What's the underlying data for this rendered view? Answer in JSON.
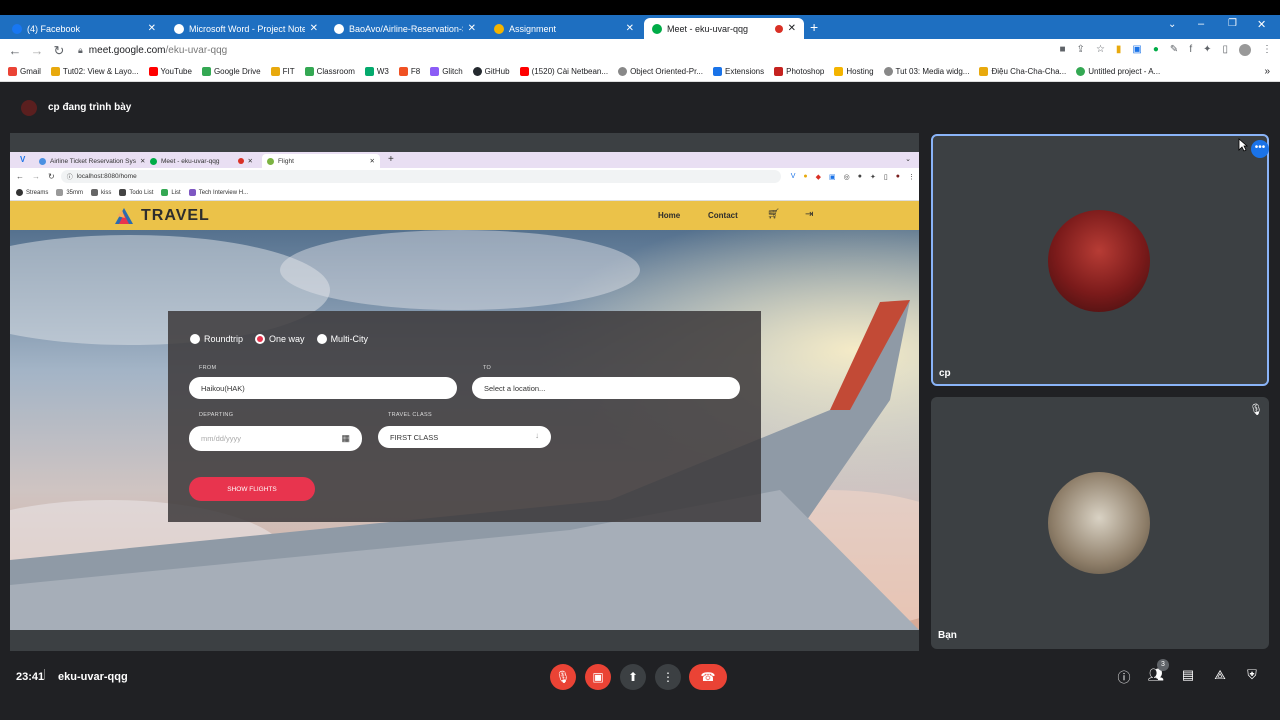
{
  "browser": {
    "tabs": [
      {
        "title": "(4) Facebook",
        "icon": "facebook-icon",
        "color": "#1877f2"
      },
      {
        "title": "Microsoft Word - Project Note",
        "icon": "globe-icon",
        "color": "#ffffff"
      },
      {
        "title": "BaoAvo/Airline-Reservation-Syst",
        "icon": "github-icon",
        "color": "#ffffff"
      },
      {
        "title": "Assignment",
        "icon": "classroom-icon",
        "color": "#f4b400"
      },
      {
        "title": "Meet - eku-uvar-qqg",
        "icon": "meet-icon",
        "color": "#00ac47"
      }
    ],
    "url_domain": "meet.google.com",
    "url_path": "/eku-uvar-qqg",
    "bookmarks": [
      "Gmail",
      "Tut02: View & Layo...",
      "YouTube",
      "Google Drive",
      "FIT",
      "Classroom",
      "W3",
      "F8",
      "Glitch",
      "GitHub",
      "(1520) Cài Netbean...",
      "Object Oriented-Pr...",
      "Extensions",
      "Photoshop",
      "Hosting",
      "Tut 03: Media widg...",
      "Điệu Cha-Cha-Cha...",
      "Untitled project - A..."
    ]
  },
  "meet": {
    "presenting_text": "cp đang trình bày",
    "participants": [
      {
        "name": "cp"
      },
      {
        "name": "Bạn"
      }
    ],
    "time": "23:41",
    "meeting_code": "eku-uvar-qqg",
    "participant_count": "3"
  },
  "inner_browser": {
    "tabs": [
      "Airline Ticket Reservation Sys",
      "Meet - eku-uvar-qqg",
      "Flight"
    ],
    "url": "localhost:8080/home",
    "bookmarks": [
      "Streams",
      "35mm",
      "kiss",
      "Todo List",
      "List",
      "Tech Interview H..."
    ]
  },
  "travel": {
    "brand": "TRAVEL",
    "nav": {
      "home": "Home",
      "contact": "Contact"
    },
    "trip_types": [
      "Roundtrip",
      "One way",
      "Multi-City"
    ],
    "selected_trip": "One way",
    "from_label": "FROM",
    "from_value": "Haikou(HAK)",
    "to_label": "TO",
    "to_placeholder": "Select a location...",
    "departing_label": "DEPARTING",
    "departing_placeholder": "mm/dd/yyyy",
    "class_label": "TRAVEL CLASS",
    "class_value": "FIRST CLASS",
    "submit": "SHOW FLIGHTS"
  },
  "colors": {
    "chrome_blue": "#1e6fc1",
    "meet_bg": "#202124",
    "navbar_yellow": "#ebc249",
    "accent_red": "#e8344e",
    "end_call_red": "#ea4335"
  }
}
